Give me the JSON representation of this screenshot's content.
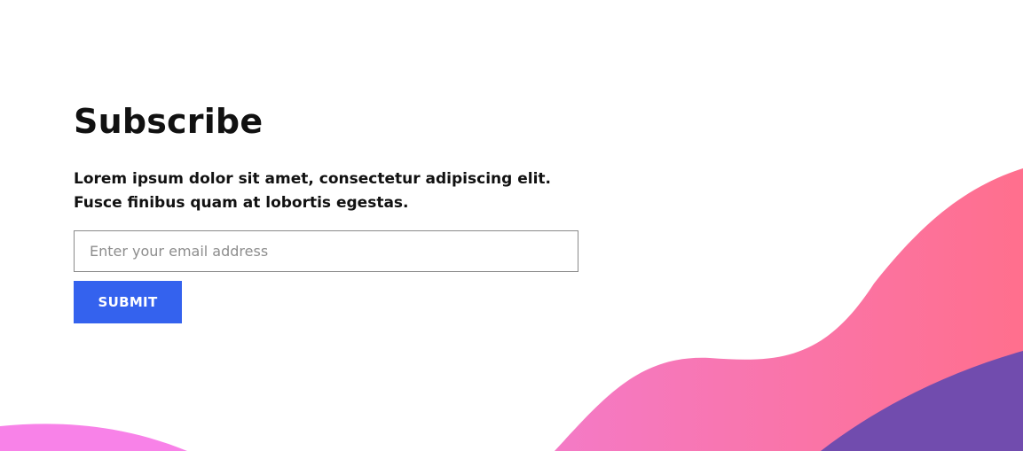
{
  "subscribe": {
    "title": "Subscribe",
    "description": "Lorem ipsum dolor sit amet, consectetur adipiscing elit. Fusce finibus quam at lobortis egestas.",
    "email_placeholder": "Enter your email address",
    "email_value": "",
    "submit_label": "SUBMIT"
  },
  "colors": {
    "accent_button": "#3462EE",
    "wave_pink_left": "#F47AC6",
    "wave_pink_right": "#FF6F8D",
    "wave_purple": "#714CAE",
    "wave_magenta": "#F882E8"
  }
}
